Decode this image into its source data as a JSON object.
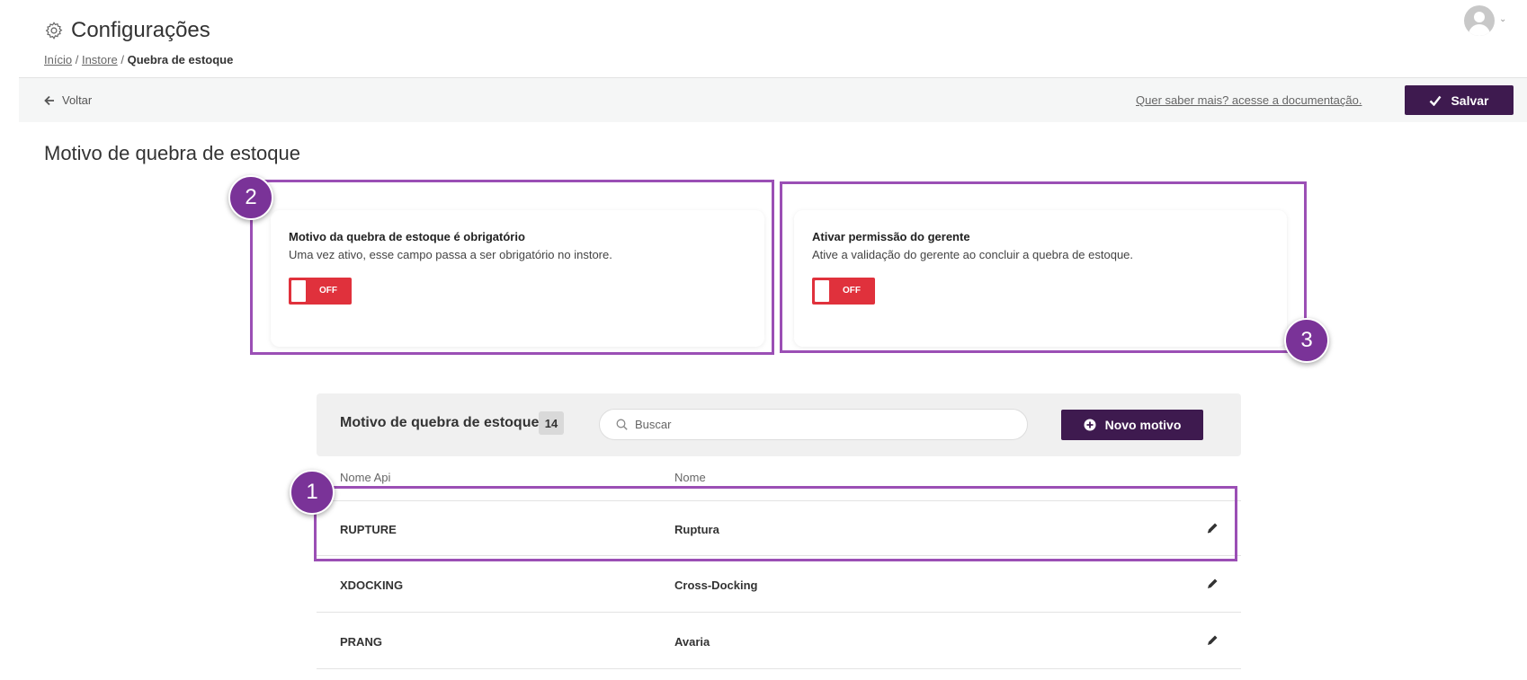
{
  "header": {
    "icon": "gear-icon",
    "title": "Configurações",
    "breadcrumb": {
      "home": "Início",
      "sep1": "/",
      "instore": "Instore",
      "sep2": "/",
      "current": "Quebra de estoque"
    },
    "user_icon": "user-avatar-icon"
  },
  "toolbar": {
    "back_label": "Voltar",
    "doc_link": "Quer saber mais? acesse a documentação.",
    "save_label": "Salvar"
  },
  "section_title": "Motivo de quebra de estoque",
  "cards": [
    {
      "title": "Motivo da quebra de estoque é obrigatório",
      "description": "Uma vez ativo, esse campo passa a ser obrigatório no instore.",
      "toggle": "OFF"
    },
    {
      "title": "Ativar permissão do gerente",
      "description": "Ative a validação do gerente ao concluir a quebra de estoque.",
      "toggle": "OFF"
    }
  ],
  "annotations": {
    "one": "1",
    "two": "2",
    "three": "3"
  },
  "list": {
    "title": "Motivo de quebra de estoque",
    "count": "14",
    "search_placeholder": "Buscar",
    "new_button": "Novo motivo",
    "columns": {
      "api": "Nome Api",
      "nome": "Nome"
    },
    "rows": [
      {
        "api": "RUPTURE",
        "nome": "Ruptura"
      },
      {
        "api": "XDOCKING",
        "nome": "Cross-Docking"
      },
      {
        "api": "PRANG",
        "nome": "Avaria"
      }
    ]
  },
  "colors": {
    "primary": "#3e1a4f",
    "toggle_off": "#e0313c",
    "annotation": "#7a3398"
  }
}
